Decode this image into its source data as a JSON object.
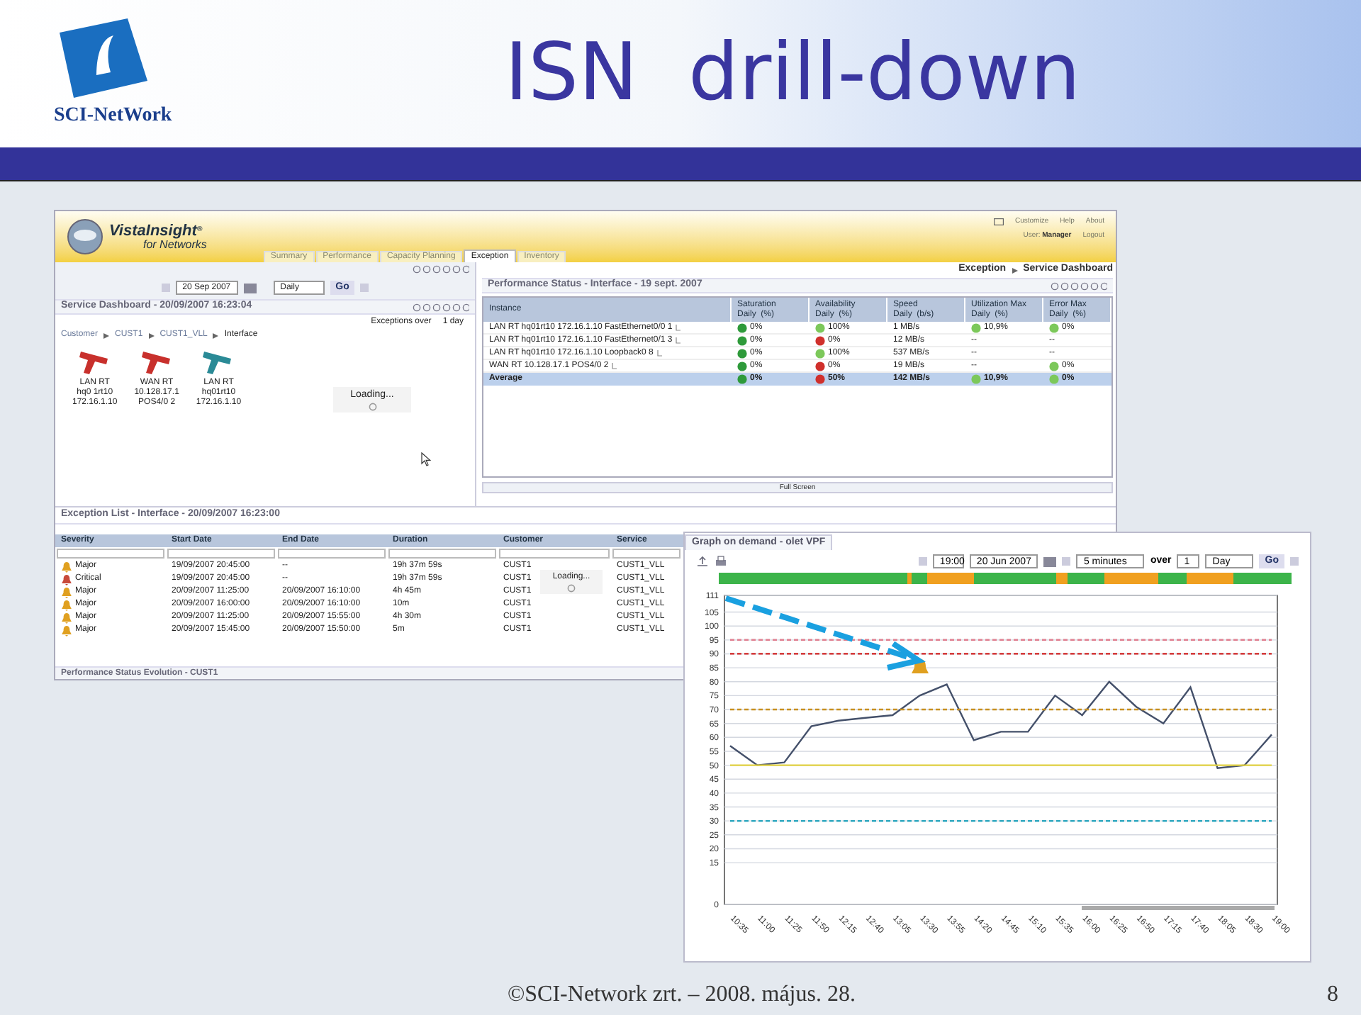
{
  "slide": {
    "logo_text": "SCI-NetWork",
    "title": "ISN  drill-down",
    "footer": "©SCI-Network zrt. – 2008. május. 28.",
    "page_number": "8"
  },
  "app": {
    "brand": "VistaInsight",
    "brand_mark": "®",
    "brand_sub": "for Networks",
    "tabs": [
      {
        "label": "Summary",
        "selected": false
      },
      {
        "label": "Performance",
        "selected": false
      },
      {
        "label": "Capacity Planning",
        "selected": false
      },
      {
        "label": "Exception",
        "selected": true
      },
      {
        "label": "Inventory",
        "selected": false
      }
    ],
    "top_links": [
      "Customize",
      "Help",
      "About"
    ],
    "user_label": "User:",
    "user_name": "Manager",
    "logout": "Logout",
    "page_path": [
      "Exception",
      "Service Dashboard"
    ],
    "date_nav": {
      "date": "20 Sep 2007",
      "period": "Daily",
      "go": "Go"
    },
    "service_dashboard": {
      "title": "Service Dashboard - 20/09/2007 16:23:04",
      "exceptions_label": "Exceptions over",
      "exceptions_value": "1 day",
      "path": [
        "Customer",
        "CUST1",
        "CUST1_VLL",
        "Interface"
      ],
      "devices": [
        {
          "lines": [
            "LAN RT",
            "hq0 1rt10",
            "172.16.1.10"
          ],
          "color": "#c8302c"
        },
        {
          "lines": [
            "WAN RT",
            "10.128.17.1",
            "POS4/0 2"
          ],
          "color": "#c8302c"
        },
        {
          "lines": [
            "LAN RT",
            "hq01rt10",
            "172.16.1.10"
          ],
          "color": "#2a8a96"
        }
      ],
      "loading": "Loading..."
    },
    "performance_status": {
      "title": "Performance Status - Interface - 19 sept. 2007",
      "columns": [
        {
          "title": "Instance"
        },
        {
          "title": "Saturation",
          "unit": "Daily  (%)"
        },
        {
          "title": "Availability",
          "unit": "Daily  (%)"
        },
        {
          "title": "Speed",
          "unit": "Daily  (b/s)"
        },
        {
          "title": "Utilization Max",
          "unit": "Daily  (%)"
        },
        {
          "title": "Error Max",
          "unit": "Daily  (%)"
        }
      ],
      "rows": [
        {
          "kind": "instance",
          "cells": [
            {
              "text": "LAN RT hq01rt10 172.16.1.10 FastEthernet0/0 1"
            },
            {
              "text": "0%",
              "color": "#2e9a3a"
            },
            {
              "text": "100%",
              "color": "#7cc85a"
            },
            {
              "text": "1 MB/s"
            },
            {
              "text": "10,9%",
              "color": "#7cc85a"
            },
            {
              "text": "0%",
              "color": "#7cc85a"
            }
          ]
        },
        {
          "kind": "instance",
          "cells": [
            {
              "text": "LAN RT hq01rt10 172.16.1.10 FastEthernet0/1 3"
            },
            {
              "text": "0%",
              "color": "#2e9a3a"
            },
            {
              "text": "0%",
              "color": "#d0302c"
            },
            {
              "text": "12 MB/s"
            },
            {
              "text": "--"
            },
            {
              "text": "--"
            }
          ]
        },
        {
          "kind": "instance",
          "cells": [
            {
              "text": "LAN RT hq01rt10 172.16.1.10 Loopback0 8"
            },
            {
              "text": "0%",
              "color": "#2e9a3a"
            },
            {
              "text": "100%",
              "color": "#7cc85a"
            },
            {
              "text": "537 MB/s"
            },
            {
              "text": "--"
            },
            {
              "text": "--"
            }
          ]
        },
        {
          "kind": "instance",
          "cells": [
            {
              "text": "WAN RT 10.128.17.1 POS4/0 2"
            },
            {
              "text": "0%",
              "color": "#2e9a3a"
            },
            {
              "text": "0%",
              "color": "#d0302c"
            },
            {
              "text": "19 MB/s"
            },
            {
              "text": "--"
            },
            {
              "text": "0%",
              "color": "#7cc85a"
            }
          ]
        },
        {
          "kind": "average",
          "cells": [
            {
              "text": "Average"
            },
            {
              "text": "0%",
              "color": "#2e9a3a"
            },
            {
              "text": "50%",
              "color": "#d0302c"
            },
            {
              "text": "142 MB/s"
            },
            {
              "text": "10,9%",
              "color": "#7cc85a"
            },
            {
              "text": "0%",
              "color": "#7cc85a"
            }
          ]
        }
      ],
      "full_screen": "Full Screen"
    },
    "exception_list": {
      "title": "Exception List - Interface - 20/09/2007 16:23:00",
      "columns": [
        "Severity",
        "Start Date",
        "End Date",
        "Duration",
        "Customer",
        "Service"
      ],
      "rows": [
        {
          "kind": "major",
          "cells": [
            "Major",
            "19/09/2007 20:45:00",
            "--",
            "19h 37m 59s",
            "CUST1",
            "CUST1_VLL"
          ]
        },
        {
          "kind": "critical",
          "cells": [
            "Critical",
            "19/09/2007 20:45:00",
            "--",
            "19h 37m 59s",
            "CUST1",
            "CUST1_VLL"
          ]
        },
        {
          "kind": "major",
          "cells": [
            "Major",
            "20/09/2007 11:25:00",
            "20/09/2007 16:10:00",
            "4h 45m",
            "CUST1",
            "CUST1_VLL"
          ]
        },
        {
          "kind": "major",
          "cells": [
            "Major",
            "20/09/2007 16:00:00",
            "20/09/2007 16:10:00",
            "10m",
            "CUST1",
            "CUST1_VLL"
          ]
        },
        {
          "kind": "major",
          "cells": [
            "Major",
            "20/09/2007 11:25:00",
            "20/09/2007 15:55:00",
            "4h 30m",
            "CUST1",
            "CUST1_VLL"
          ]
        },
        {
          "kind": "major",
          "cells": [
            "Major",
            "20/09/2007 15:45:00",
            "20/09/2007 15:50:00",
            "5m",
            "CUST1",
            "CUST1_VLL"
          ]
        }
      ],
      "loading": "Loading...",
      "next_title": "Performance Status Evolution - CUST1"
    }
  },
  "graph": {
    "title": "Graph on demand - olet VPF",
    "time": "19:00",
    "date": "20 Jun 2007",
    "step": "5 minutes",
    "over_label": "over",
    "count": "1",
    "unit": "Day",
    "go": "Go",
    "chart_data": {
      "type": "line",
      "categories": [
        "10:35",
        "11:00",
        "11:25",
        "11:50",
        "12:15",
        "12:40",
        "13:05",
        "13:30",
        "13:55",
        "14:20",
        "14:45",
        "15:10",
        "15:35",
        "16:00",
        "16:25",
        "16:50",
        "17:15",
        "17:40",
        "18:05",
        "18:30",
        "19:00"
      ],
      "series": [
        {
          "color": "#44506a",
          "line_style": "solid",
          "values": [
            57,
            50,
            51,
            64,
            66,
            67,
            68,
            75,
            79,
            59,
            62,
            62,
            75,
            68,
            80,
            71,
            65,
            78,
            49,
            50,
            61
          ]
        },
        {
          "color": "#e08090",
          "line_style": "dashed",
          "values": [
            95,
            95,
            95,
            95,
            95,
            95,
            95,
            95,
            95,
            95,
            95,
            95,
            95,
            95,
            95,
            95,
            95,
            95,
            95,
            95,
            95
          ]
        },
        {
          "color": "#d02020",
          "line_style": "dashed",
          "values": [
            90,
            90,
            90,
            90,
            90,
            90,
            90,
            90,
            90,
            90,
            90,
            90,
            90,
            90,
            90,
            90,
            90,
            90,
            90,
            90,
            90
          ]
        },
        {
          "color": "#c89020",
          "line_style": "dashed",
          "values": [
            70,
            70,
            70,
            70,
            70,
            70,
            70,
            70,
            70,
            70,
            70,
            70,
            70,
            70,
            70,
            70,
            70,
            70,
            70,
            70,
            70
          ]
        },
        {
          "color": "#e0d040",
          "line_style": "solid",
          "values": [
            50,
            50,
            50,
            50,
            50,
            50,
            50,
            50,
            50,
            50,
            50,
            50,
            50,
            50,
            50,
            50,
            50,
            50,
            50,
            50,
            50
          ]
        },
        {
          "color": "#30a8c0",
          "line_style": "dashed",
          "values": [
            30,
            30,
            30,
            30,
            30,
            30,
            30,
            30,
            30,
            30,
            30,
            30,
            30,
            30,
            30,
            30,
            30,
            30,
            30,
            30,
            30
          ]
        }
      ],
      "ylim": [
        0,
        111
      ],
      "yticks": [
        0,
        15,
        20,
        25,
        30,
        35,
        40,
        45,
        50,
        55,
        60,
        65,
        70,
        75,
        80,
        85,
        90,
        95,
        100,
        105,
        111
      ],
      "grid": true
    }
  }
}
